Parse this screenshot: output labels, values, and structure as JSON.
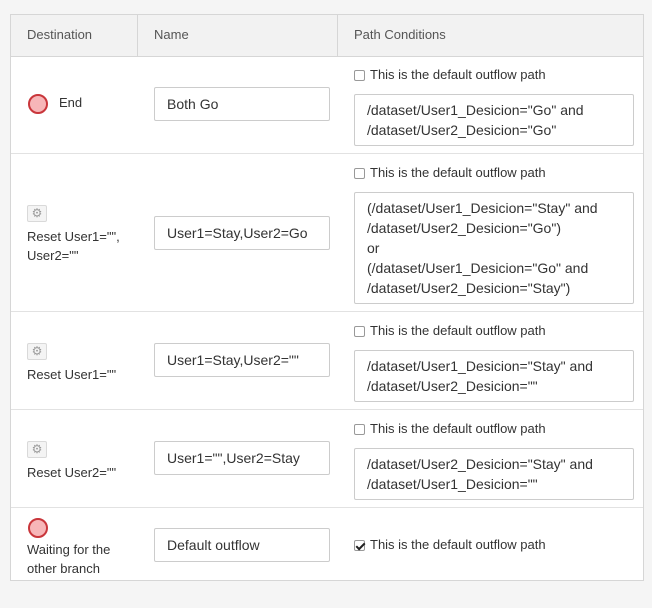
{
  "header": {
    "destination": "Destination",
    "name": "Name",
    "path_conditions": "Path Conditions"
  },
  "default_label": "This is the default outflow path",
  "rows": [
    {
      "destination": "End",
      "destination_icon": "end-circle-icon",
      "name": "Both Go",
      "is_default": false,
      "condition": "/dataset/User1_Desicion=\"Go\" and\n/dataset/User2_Desicion=\"Go\""
    },
    {
      "destination": "Reset User1=\"\",\nUser2=\"\"",
      "destination_icon": "gear-icon",
      "name": "User1=Stay,User2=Go",
      "is_default": false,
      "condition": "(/dataset/User1_Desicion=\"Stay\" and\n/dataset/User2_Desicion=\"Go\")\nor\n(/dataset/User1_Desicion=\"Go\" and\n/dataset/User2_Desicion=\"Stay\")"
    },
    {
      "destination": "Reset User1=\"\"",
      "destination_icon": "gear-icon",
      "name": "User1=Stay,User2=\"\"",
      "is_default": false,
      "condition": "/dataset/User1_Desicion=\"Stay\" and\n/dataset/User2_Desicion=\"\""
    },
    {
      "destination": "Reset User2=\"\"",
      "destination_icon": "gear-icon",
      "name": "User1=\"\",User2=Stay",
      "is_default": false,
      "condition": "/dataset/User2_Desicion=\"Stay\" and\n/dataset/User1_Desicion=\"\""
    },
    {
      "destination": "Waiting for the\nother branch",
      "destination_icon": "end-circle-icon",
      "name": "Default outflow",
      "is_default": true,
      "condition": ""
    }
  ]
}
